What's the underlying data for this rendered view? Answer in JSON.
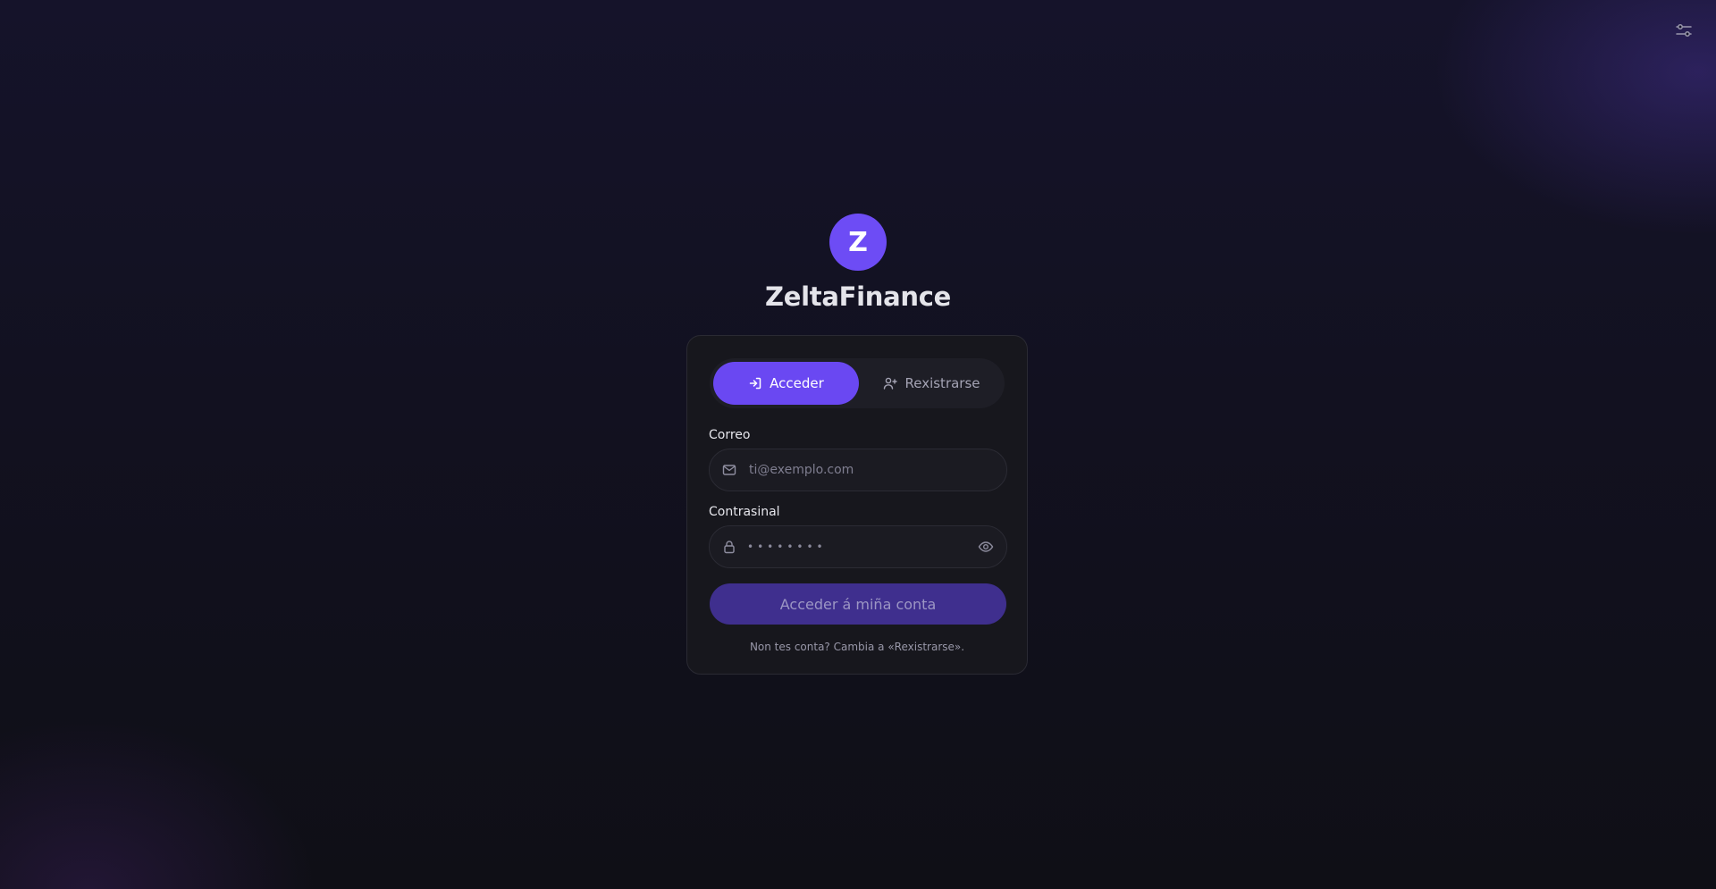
{
  "header": {
    "settings_icon": "sliders-icon"
  },
  "brand": {
    "logo_letter": "Z",
    "name": "ZeltaFinance",
    "accent_color": "#6d4cf5"
  },
  "tabs": [
    {
      "label": "Acceder",
      "icon": "login-icon",
      "active": true
    },
    {
      "label": "Rexistrarse",
      "icon": "user-plus-icon",
      "active": false
    }
  ],
  "form": {
    "email": {
      "label": "Correo",
      "placeholder": "ti@exemplo.com",
      "value": "",
      "icon": "mail-icon"
    },
    "password": {
      "label": "Contrasinal",
      "masked_value": "••••••••",
      "icon": "lock-icon",
      "toggle_icon": "eye-icon"
    },
    "submit_label": "Acceder á miña conta",
    "hint": "Non tes conta? Cambia a «Rexistrarse»."
  }
}
